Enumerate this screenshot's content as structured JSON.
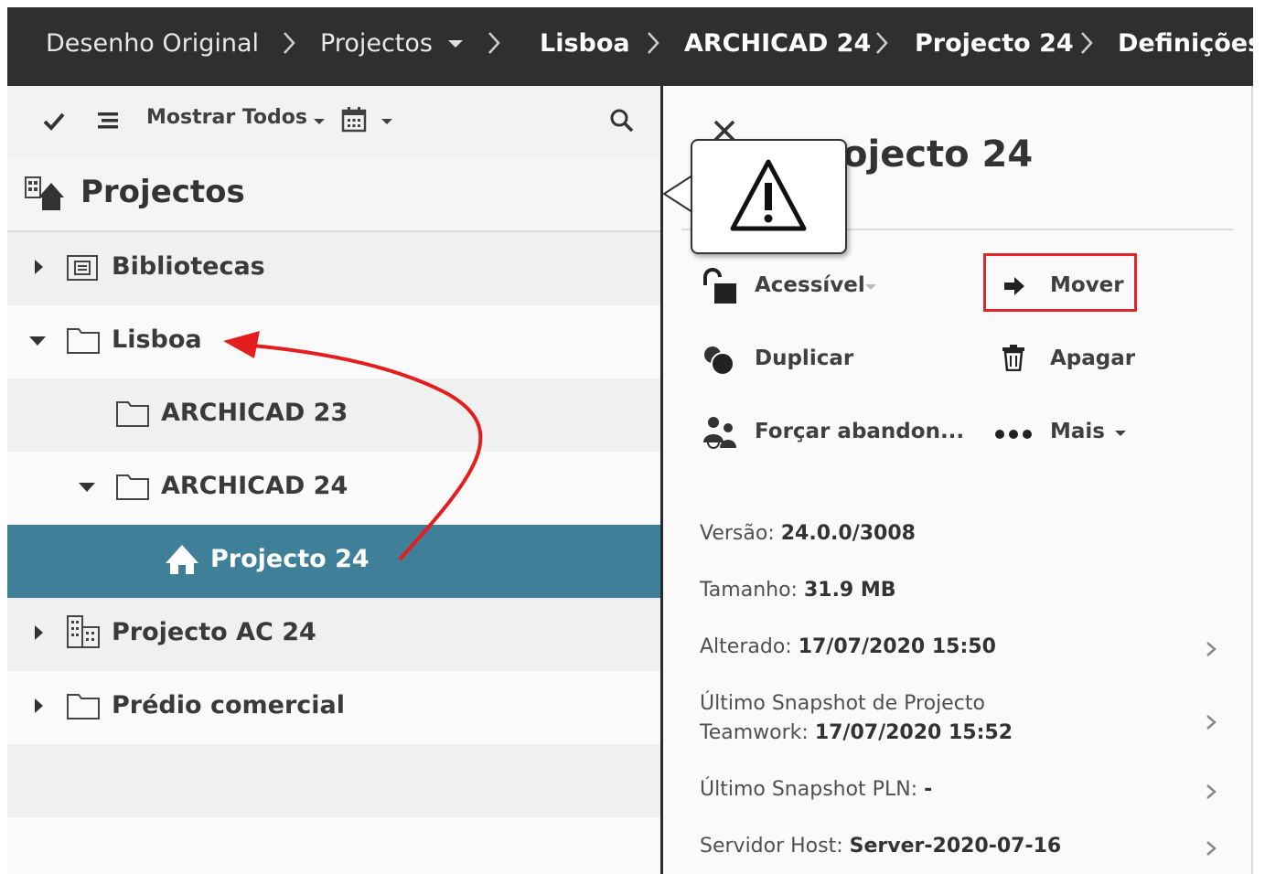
{
  "breadcrumb": {
    "items": [
      {
        "label": "Desenho Original"
      },
      {
        "label": "Projectos"
      },
      {
        "label": "Lisboa"
      },
      {
        "label": "ARCHICAD 24"
      },
      {
        "label": "Projecto 24"
      },
      {
        "label": "Definições"
      }
    ]
  },
  "toolbar": {
    "filter_label": "Mostrar Todos"
  },
  "tree": {
    "header": "Projectos",
    "items": [
      {
        "label": "Bibliotecas"
      },
      {
        "label": "Lisboa"
      },
      {
        "label": "ARCHICAD 23"
      },
      {
        "label": "ARCHICAD 24"
      },
      {
        "label": "Projecto 24"
      },
      {
        "label": "Projecto AC 24"
      },
      {
        "label": "Prédio comercial"
      }
    ]
  },
  "details": {
    "title": "Projecto 24",
    "title_visible": "ojecto 24",
    "actions": {
      "access": "Acessível",
      "move": "Mover",
      "duplicate": "Duplicar",
      "delete": "Apagar",
      "force": "Forçar abandon...",
      "more": "Mais"
    },
    "info": {
      "version_label": "Versão:",
      "version_value": "24.0.0/3008",
      "size_label": "Tamanho:",
      "size_value": "31.9 MB",
      "modified_label": "Alterado:",
      "modified_value": "17/07/2020 15:50",
      "snapshot_label_1": "Último Snapshot de Projecto",
      "snapshot_label_2": "Teamwork:",
      "snapshot_value": "17/07/2020 15:52",
      "pln_label": "Último Snapshot PLN:",
      "pln_value": "-",
      "host_label": "Servidor Host:",
      "host_value": "Server-2020-07-16"
    }
  },
  "colors": {
    "topbar": "#2f2f2f",
    "selection": "#3f8098",
    "highlight_box": "#e0262b",
    "annotation_arrow": "#e41e1e"
  }
}
